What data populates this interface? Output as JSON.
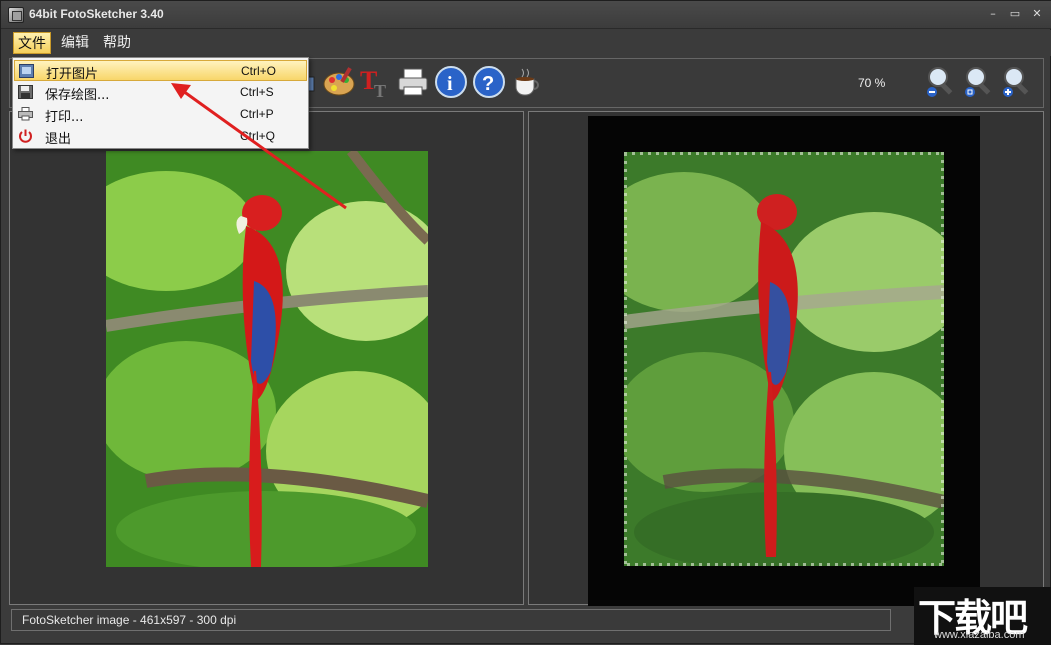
{
  "window": {
    "title": "64bit FotoSketcher 3.40",
    "controls": {
      "minimize": "–",
      "maximize": "▭",
      "close": "✕"
    }
  },
  "menubar": {
    "items": [
      {
        "label": "文件",
        "active": true
      },
      {
        "label": "编辑",
        "active": false
      },
      {
        "label": "帮助",
        "active": false
      }
    ]
  },
  "file_menu": {
    "items": [
      {
        "label": "打开图片",
        "shortcut": "Ctrl+O",
        "icon": "open-image-icon",
        "highlighted": true
      },
      {
        "label": "保存绘图...",
        "shortcut": "Ctrl+S",
        "icon": "floppy-disk-icon",
        "highlighted": false
      },
      {
        "label": "打印...",
        "shortcut": "Ctrl+P",
        "icon": "printer-icon",
        "highlighted": false
      },
      {
        "label": "退出",
        "shortcut": "Ctrl+Q",
        "icon": "power-icon",
        "highlighted": false
      }
    ]
  },
  "toolbar": {
    "zoom_level": "70 %",
    "icons": [
      "image-frame-icon",
      "palette-icon",
      "text-tool-icon",
      "printer-icon",
      "info-icon",
      "help-icon",
      "coffee-cup-icon",
      "zoom-out-icon",
      "zoom-fit-icon",
      "zoom-in-icon"
    ]
  },
  "status": {
    "text": "FotoSketcher image - 461x597 - 300 dpi"
  },
  "watermark": {
    "text": "下载吧",
    "url": "www.xiazaiba.com"
  },
  "colors": {
    "accent_highlight": "#f8d66a",
    "arrow": "#e02020",
    "background": "#3b3b3b"
  }
}
